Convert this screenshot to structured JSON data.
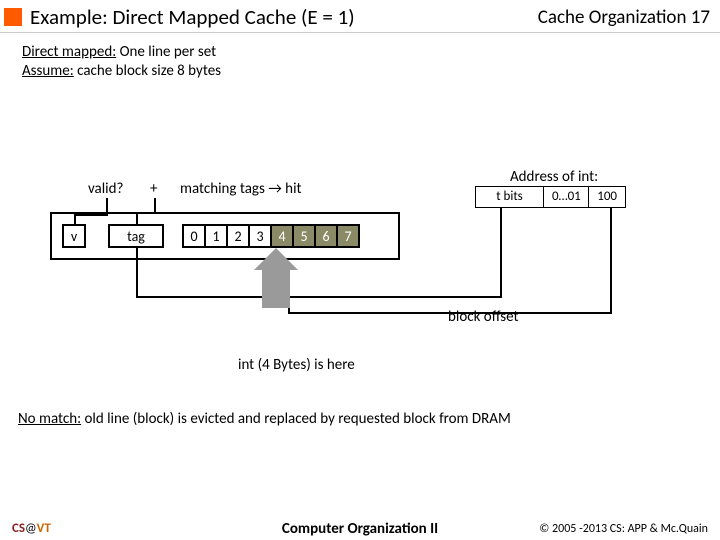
{
  "header": {
    "title": "Example: Direct Mapped Cache (E = 1)",
    "section": "Cache Organization",
    "page": "17"
  },
  "subtitle": {
    "line1_u": "Direct mapped:",
    "line1_rest": " One line per set",
    "line2_u": "Assume:",
    "line2_rest": " cache block size 8 bytes"
  },
  "labels": {
    "valid": "valid?",
    "plus": "+",
    "matching": "matching tags → hit",
    "v": "v",
    "tag": "tag",
    "addr_title": "Address of int:",
    "block_offset": "block offset",
    "int_here": "int (4 Bytes) is here"
  },
  "bytes": [
    "0",
    "1",
    "2",
    "3",
    "4",
    "5",
    "6",
    "7"
  ],
  "addr": {
    "tbits": "t bits",
    "set": "0…01",
    "off": "100"
  },
  "nomatch": {
    "u": "No match:",
    "rest": " old line (block) is evicted and replaced by requested block from DRAM"
  },
  "footer": {
    "cs": "CS",
    "at": "@",
    "vt": "VT",
    "center": "Computer Organization II",
    "right": "© 2005 -2013 CS: APP & Mc.Quain"
  }
}
